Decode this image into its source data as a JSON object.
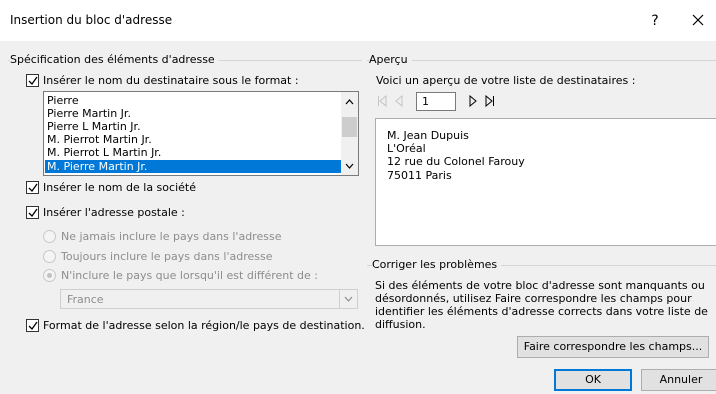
{
  "dialog": {
    "title": "Insertion du bloc d'adresse",
    "help": "?",
    "close_icon": "close-icon"
  },
  "spec": {
    "group_title": "Spécification des éléments d'adresse",
    "insert_name": {
      "label": "Insérer le nom du destinataire sous le format :",
      "checked": true
    },
    "name_formats": [
      "Pierre",
      "Pierre Martin Jr.",
      "Pierre L Martin Jr.",
      "M. Pierrot Martin Jr.",
      "M. Pierrot L Martin Jr.",
      "M. Pierre Martin Jr."
    ],
    "selected_format_index": 5,
    "insert_company": {
      "label": "Insérer le nom de la société",
      "checked": true
    },
    "insert_address": {
      "label": "Insérer l'adresse postale :",
      "checked": true
    },
    "country_options": [
      "Ne jamais inclure le pays dans l'adresse",
      "Toujours inclure le pays dans l'adresse",
      "N'inclure le pays que lorsqu'il est différent de :"
    ],
    "country_selected_index": 2,
    "country_value": "France",
    "format_by_region": {
      "label": "Format de l'adresse selon la région/le pays de destination.",
      "checked": true
    }
  },
  "preview": {
    "group_title": "Aperçu",
    "caption": "Voici un aperçu de votre liste de destinataires :",
    "record_number": "1",
    "lines": [
      "M. Jean Dupuis",
      "L'Oréal",
      "12 rue du Colonel Farouy",
      "75011 Paris"
    ]
  },
  "problems": {
    "group_title": "Corriger les problèmes",
    "text": "Si des éléments de votre bloc d'adresse sont manquants ou désordonnés, utilisez Faire correspondre les champs pour identifier les éléments d'adresse corrects dans votre liste de diffusion.",
    "match_button": "Faire correspondre les champs..."
  },
  "footer": {
    "ok": "OK",
    "cancel": "Annuler"
  }
}
